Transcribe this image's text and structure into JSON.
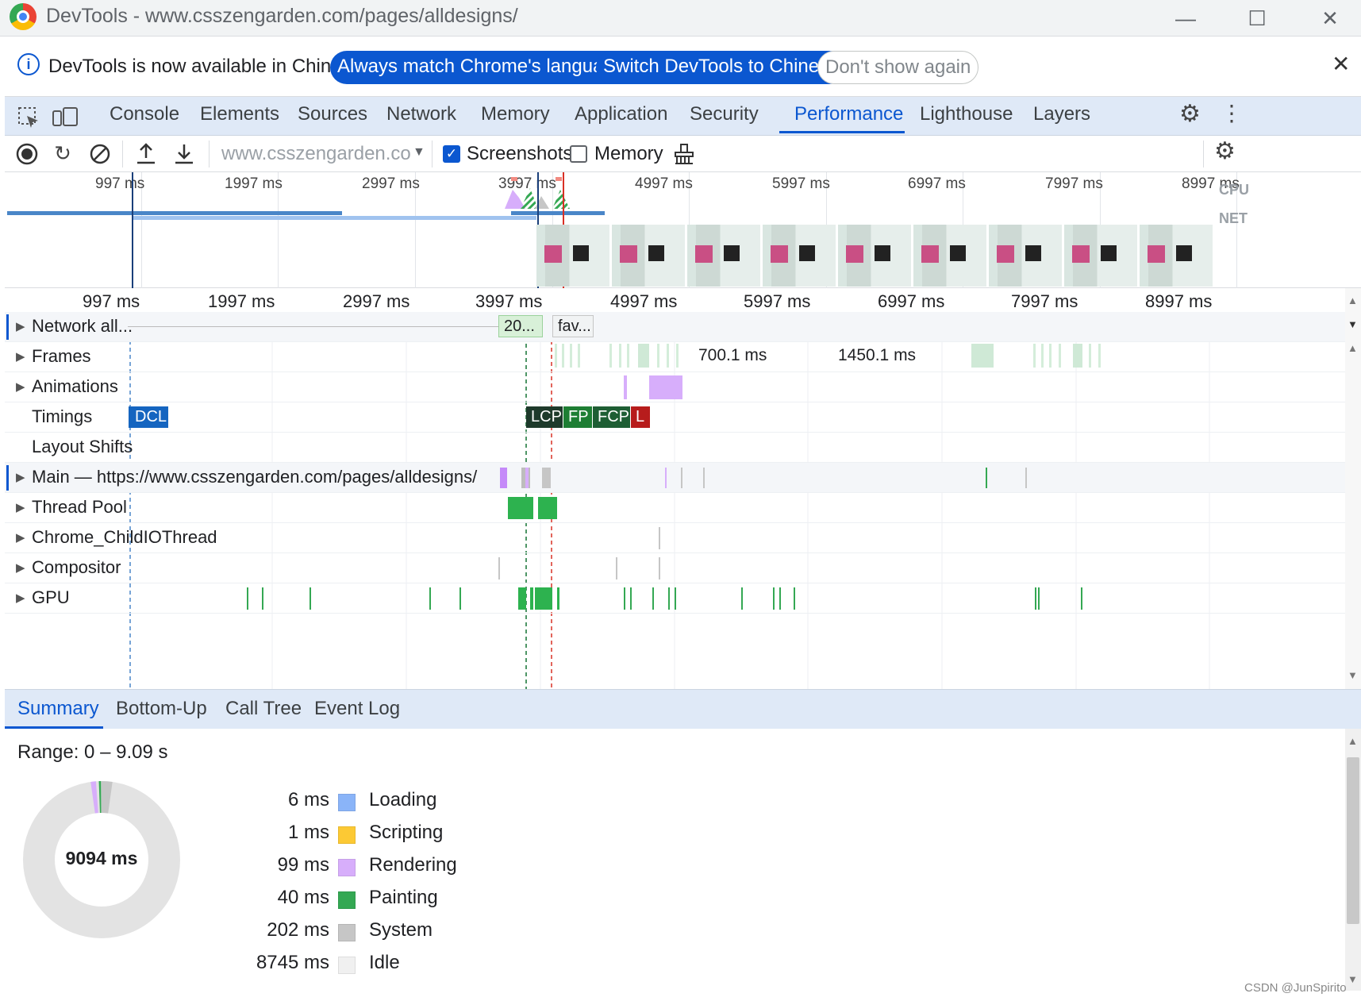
{
  "window": {
    "title": "DevTools - www.csszengarden.com/pages/alldesigns/",
    "minimize": "—",
    "maximize": "☐",
    "close": "✕"
  },
  "infobar": {
    "message": "DevTools is now available in Chinese!",
    "btn_match": "Always match Chrome's language",
    "btn_switch": "Switch DevTools to Chinese",
    "btn_dismiss": "Don't show again",
    "close": "✕"
  },
  "tabs": [
    "Console",
    "Elements",
    "Sources",
    "Network",
    "Memory",
    "Application",
    "Security",
    "Performance",
    "Lighthouse",
    "Layers"
  ],
  "active_tab": "Performance",
  "toolbar": {
    "url": "www.csszengarden.com...",
    "screenshots_label": "Screenshots",
    "screenshots_checked": true,
    "memory_label": "Memory",
    "memory_checked": false
  },
  "overview": {
    "ticks": [
      "997 ms",
      "1997 ms",
      "2997 ms",
      "3997 ms",
      "4997 ms",
      "5997 ms",
      "6997 ms",
      "7997 ms",
      "8997 ms"
    ],
    "cpu_label": "CPU",
    "net_label": "NET"
  },
  "ruler": {
    "ticks": [
      "997 ms",
      "1997 ms",
      "2997 ms",
      "3997 ms",
      "4997 ms",
      "5997 ms",
      "6997 ms",
      "7997 ms",
      "8997 ms"
    ]
  },
  "tracks": {
    "network": {
      "label": "Network all...",
      "req1": "20...",
      "req2": "fav..."
    },
    "frames": {
      "label": "Frames",
      "t1": "700.1 ms",
      "t2": "1450.1 ms"
    },
    "animations": {
      "label": "Animations"
    },
    "timings": {
      "label": "Timings",
      "dcl": "DCL",
      "lcp": "LCP",
      "fp": "FP",
      "fcp": "FCP",
      "l": "L"
    },
    "layout_shifts": {
      "label": "Layout Shifts"
    },
    "main": {
      "label": "Main — https://www.csszengarden.com/pages/alldesigns/"
    },
    "thread_pool": {
      "label": "Thread Pool"
    },
    "child_io": {
      "label": "Chrome_ChildIOThread"
    },
    "compositor": {
      "label": "Compositor"
    },
    "gpu": {
      "label": "GPU"
    }
  },
  "bottom_tabs": [
    "Summary",
    "Bottom-Up",
    "Call Tree",
    "Event Log"
  ],
  "summary": {
    "range": "Range: 0 – 9.09 s",
    "total": "9094 ms",
    "rows": [
      {
        "value": "6 ms",
        "label": "Loading",
        "color": "#8ab4f8"
      },
      {
        "value": "1 ms",
        "label": "Scripting",
        "color": "#fcc934"
      },
      {
        "value": "99 ms",
        "label": "Rendering",
        "color": "#d7aefb"
      },
      {
        "value": "40 ms",
        "label": "Painting",
        "color": "#34a853"
      },
      {
        "value": "202 ms",
        "label": "System",
        "color": "#c6c6c6"
      },
      {
        "value": "8745 ms",
        "label": "Idle",
        "color": "#f0f0f0"
      }
    ]
  },
  "watermark": "CSDN @JunSpirito",
  "colors": {
    "accent": "#0b57d0",
    "tab_bg": "#dfe9f7"
  }
}
